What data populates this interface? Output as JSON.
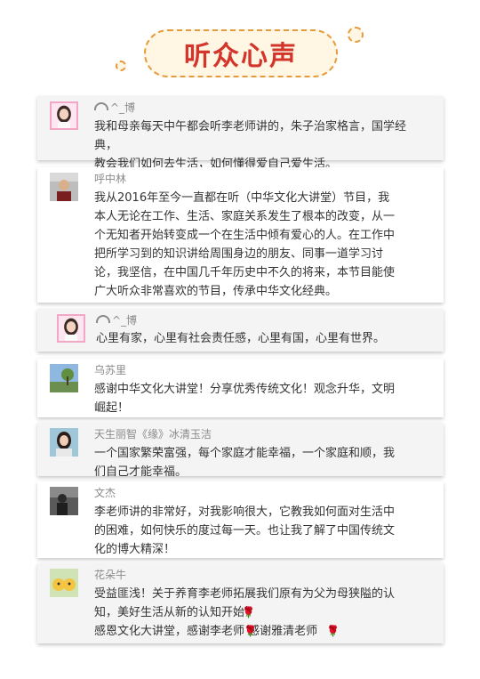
{
  "header": {
    "title": "听众心声"
  },
  "comments": [
    {
      "user": "^_博",
      "text": "我和母亲每天中午都会听李老师讲的，朱子治家格言，国学经典，\n教会我们如何去生活，如何懂得爱自己爱生活。",
      "avatar": "girl-portrait-icon"
    },
    {
      "user": "呼中林",
      "text": "我从2016年至今一直都在听（中华文化大讲堂）节目，我\n本人无论在工作、生活、家庭关系发生了根本的改变，从一\n个无知者开始转变成一个在生活中倾有爱心的人。在工作中\n把所学习到的知识讲给周围身边的朋友、同事一道学习讨\n论，我坚信，在中国几千年历史中不久的将来，本节目能使\n广大听众非常喜欢的节目，传承中华文化经典。",
      "avatar": "man-portrait-icon"
    },
    {
      "user": "^_博",
      "text": "心里有家，心里有社会责任感，心里有国，心里有世界。",
      "avatar": "girl-portrait-icon"
    },
    {
      "user": "乌苏里",
      "text": "感谢中华文化大讲堂！分享优秀传统文化！观念升华，文明\n崛起！",
      "avatar": "tree-icon"
    },
    {
      "user": "天生丽智《缘》冰清玉洁",
      "text": "一个国家繁荣富强，每个家庭才能幸福，一个家庭和顺，我\n们自己才能幸福。",
      "avatar": "woman-portrait-icon"
    },
    {
      "user": "文杰",
      "text": "李老师讲的非常好，对我影响很大，它教我如何面对生活中\n的困难，如何快乐的度过每一天。也让我了解了中国传统文\n化的博大精深！",
      "avatar": "person-dark-icon"
    },
    {
      "user": "花朵牛",
      "text": "受益匪浅！关于养育李老师拓展我们原有为父为母狭隘的认\n知，美好生活从新的认知开始\n感恩文化大讲堂，感谢李老师     感谢雅清老师",
      "avatar": "cartoon-icon"
    }
  ],
  "colors": {
    "title": "#d4352a",
    "accent_border": "#e59b3c",
    "title_bg": "#fff6e4"
  }
}
